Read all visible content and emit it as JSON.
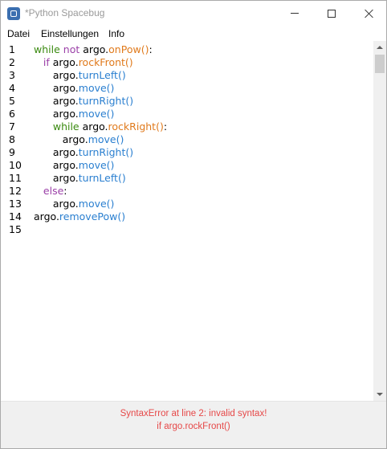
{
  "window": {
    "title": "*Python Spacebug",
    "icon": "spacebug-app-icon"
  },
  "menu": {
    "items": [
      {
        "label": "Datei"
      },
      {
        "label": "Einstellungen"
      },
      {
        "label": "Info"
      }
    ]
  },
  "editor": {
    "line_numbers": [
      "1",
      "2",
      "3",
      "4",
      "5",
      "6",
      "7",
      "8",
      "9",
      "10",
      "11",
      "12",
      "13",
      "14",
      "15"
    ],
    "colors": {
      "keyword_loop": "#3a8a10",
      "keyword_cond": "#9b40a8",
      "sensor_call": "#e07a1c",
      "action_call": "#2a7fd0",
      "plain": "#000000"
    },
    "lines": [
      [
        {
          "t": "while",
          "c": "kw-green"
        },
        {
          "t": " ",
          "c": "plain"
        },
        {
          "t": "not",
          "c": "kw-purple"
        },
        {
          "t": " argo.",
          "c": "plain"
        },
        {
          "t": "onPow()",
          "c": "fn-orange"
        },
        {
          "t": ":",
          "c": "plain"
        }
      ],
      [
        {
          "t": "   ",
          "c": "plain"
        },
        {
          "t": "if",
          "c": "kw-purple"
        },
        {
          "t": " argo.",
          "c": "plain"
        },
        {
          "t": "rockFront()",
          "c": "fn-orange"
        }
      ],
      [
        {
          "t": "      argo.",
          "c": "plain"
        },
        {
          "t": "turnLeft()",
          "c": "fn-blue"
        }
      ],
      [
        {
          "t": "      argo.",
          "c": "plain"
        },
        {
          "t": "move()",
          "c": "fn-blue"
        }
      ],
      [
        {
          "t": "      argo.",
          "c": "plain"
        },
        {
          "t": "turnRight()",
          "c": "fn-blue"
        }
      ],
      [
        {
          "t": "      argo.",
          "c": "plain"
        },
        {
          "t": "move()",
          "c": "fn-blue"
        }
      ],
      [
        {
          "t": "      ",
          "c": "plain"
        },
        {
          "t": "while",
          "c": "kw-green"
        },
        {
          "t": " argo.",
          "c": "plain"
        },
        {
          "t": "rockRight()",
          "c": "fn-orange"
        },
        {
          "t": ":",
          "c": "plain"
        }
      ],
      [
        {
          "t": "         argo.",
          "c": "plain"
        },
        {
          "t": "move()",
          "c": "fn-blue"
        }
      ],
      [
        {
          "t": "      argo.",
          "c": "plain"
        },
        {
          "t": "turnRight()",
          "c": "fn-blue"
        }
      ],
      [
        {
          "t": "      argo.",
          "c": "plain"
        },
        {
          "t": "move()",
          "c": "fn-blue"
        }
      ],
      [
        {
          "t": "      argo.",
          "c": "plain"
        },
        {
          "t": "turnLeft()",
          "c": "fn-blue"
        }
      ],
      [
        {
          "t": "   ",
          "c": "plain"
        },
        {
          "t": "else",
          "c": "kw-purple"
        },
        {
          "t": ":",
          "c": "plain"
        }
      ],
      [
        {
          "t": "      argo.",
          "c": "plain"
        },
        {
          "t": "move()",
          "c": "fn-blue"
        }
      ],
      [
        {
          "t": "argo.",
          "c": "plain"
        },
        {
          "t": "removePow()",
          "c": "fn-blue"
        }
      ],
      []
    ]
  },
  "status": {
    "error_line1": "SyntaxError at line 2: invalid syntax!",
    "error_line2": "if argo.rockFront()",
    "error_color": "#e64848"
  }
}
